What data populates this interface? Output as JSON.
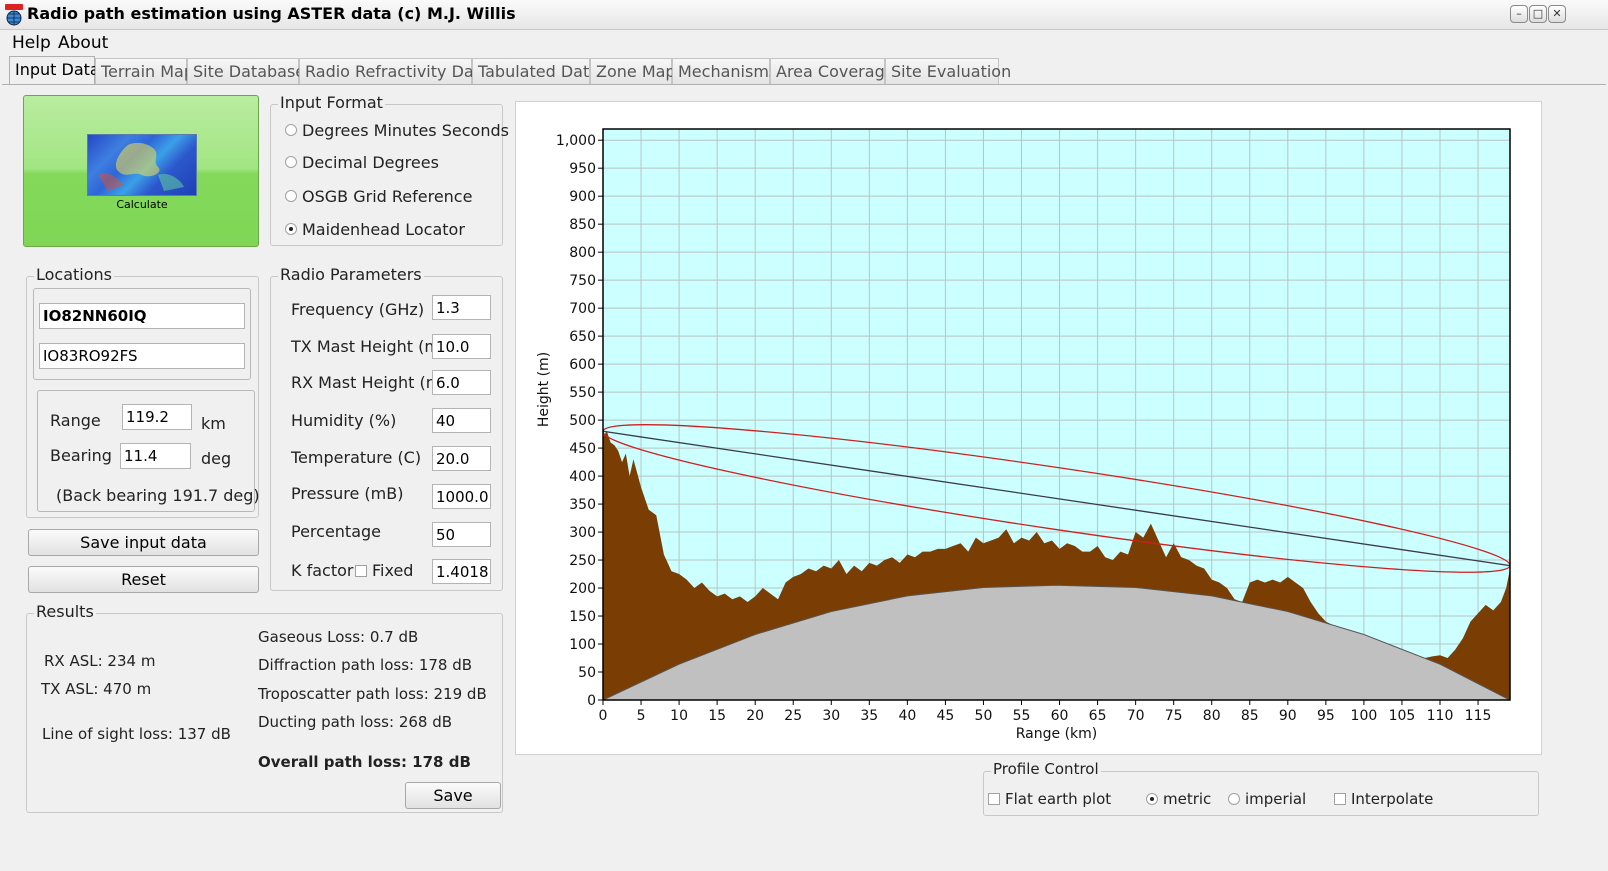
{
  "window": {
    "title": "Radio path estimation using ASTER data (c) M.J. Willis",
    "icon": "globe-app-icon",
    "controls": [
      "minimize",
      "maximize",
      "close"
    ]
  },
  "menu": [
    "Help",
    "About"
  ],
  "tabs": [
    "Input Data",
    "Terrain Map",
    "Site Database",
    "Radio Refractivity Data",
    "Tabulated Data",
    "Zone Map",
    "Mechanisms",
    "Area Coverage",
    "Site Evaluation"
  ],
  "active_tab": "Input Data",
  "calculate": {
    "label": "Calculate",
    "color": "#8fdf67"
  },
  "input_format": {
    "title": "Input Format",
    "options": [
      "Degrees Minutes Seconds",
      "Decimal Degrees",
      "OSGB Grid Reference",
      "Maidenhead Locator"
    ],
    "selected": "Maidenhead Locator"
  },
  "locations": {
    "title": "Locations",
    "tx": "IO82NN60IQ",
    "rx": "IO83RO92FS",
    "range_label": "Range",
    "range_value": "119.2",
    "range_unit": "km",
    "bearing_label": "Bearing",
    "bearing_value": "11.4",
    "bearing_unit": "deg",
    "back_bearing": "(Back bearing 191.7 deg)"
  },
  "buttons": {
    "save_input": "Save input data",
    "reset": "Reset",
    "save": "Save"
  },
  "radio_parameters": {
    "title": "Radio Parameters",
    "rows": [
      {
        "label": "Frequency (GHz)",
        "value": "1.3"
      },
      {
        "label": "TX Mast Height (m)",
        "value": "10.0"
      },
      {
        "label": "RX Mast Height (m)",
        "value": "6.0"
      },
      {
        "label": "Humidity (%)",
        "value": "40"
      },
      {
        "label": "Temperature (C)",
        "value": "20.0"
      },
      {
        "label": "Pressure (mB)",
        "value": "1000.0"
      },
      {
        "label": "Percentage",
        "value": "50"
      }
    ],
    "k_factor_label": "K factor",
    "fixed_label": "Fixed",
    "k_factor_value": "1.4018"
  },
  "results": {
    "title": "Results",
    "rx_asl": "RX ASL: 234 m",
    "tx_asl": "TX ASL: 470 m",
    "los_loss": "Line of sight loss: 137 dB",
    "gaseous_loss": "Gaseous Loss: 0.7 dB",
    "diffraction_loss": "Diffraction path loss: 178 dB",
    "troposcatter_loss": "Troposcatter path loss: 219 dB",
    "ducting_loss": "Ducting path loss: 268 dB",
    "overall_loss": "Overall path loss: 178 dB"
  },
  "profile_control": {
    "title": "Profile Control",
    "flat_earth": "Flat earth plot",
    "metric": "metric",
    "imperial": "imperial",
    "interpolate": "Interpolate",
    "units_selected": "metric"
  },
  "chart_data": {
    "type": "area",
    "xlabel": "Range (km)",
    "ylabel": "Height (m)",
    "xlim": [
      0,
      119.2
    ],
    "ylim": [
      0,
      1020
    ],
    "xticks": [
      0,
      5,
      10,
      15,
      20,
      25,
      30,
      35,
      40,
      45,
      50,
      55,
      60,
      65,
      70,
      75,
      80,
      85,
      90,
      95,
      100,
      105,
      110,
      115
    ],
    "yticks": [
      0,
      50,
      100,
      150,
      200,
      250,
      300,
      350,
      400,
      450,
      500,
      550,
      600,
      650,
      700,
      750,
      800,
      850,
      900,
      950,
      1000
    ],
    "ytick_labels": [
      "0",
      "50",
      "100",
      "150",
      "200",
      "250",
      "300",
      "350",
      "400",
      "450",
      "500",
      "550",
      "600",
      "650",
      "700",
      "750",
      "800",
      "850",
      "900",
      "950",
      "1,000"
    ],
    "grid": true,
    "background": "#ccffff",
    "terrain_color": "#7a3e05",
    "earth_color": "#c0c0c0",
    "los_color": "#3a3a48",
    "fresnel_color": "#cc2020",
    "earth_bulge": {
      "x": [
        0,
        10,
        20,
        30,
        40,
        50,
        59.6,
        70,
        80,
        90,
        100,
        110,
        119.2
      ],
      "y": [
        0,
        64,
        117,
        158,
        186,
        201,
        205,
        201,
        186,
        158,
        117,
        64,
        0
      ]
    },
    "terrain": {
      "x": [
        0,
        0.5,
        1,
        1.5,
        2,
        2.5,
        3,
        3.5,
        4,
        5,
        6,
        7,
        8,
        9,
        10,
        11,
        12,
        13,
        14,
        15,
        16,
        17,
        18,
        19,
        20,
        21,
        22,
        23,
        24,
        25,
        26,
        27,
        28,
        29,
        30,
        31,
        32,
        33,
        34,
        35,
        36,
        37,
        38,
        39,
        40,
        41,
        42,
        43,
        44,
        45,
        46,
        47,
        48,
        49,
        50,
        51,
        52,
        53,
        54,
        55,
        56,
        57,
        58,
        59,
        60,
        61,
        62,
        63,
        64,
        65,
        66,
        67,
        68,
        69,
        70,
        71,
        72,
        73,
        74,
        75,
        76,
        77,
        78,
        79,
        80,
        81,
        82,
        83,
        84,
        85,
        86,
        87,
        88,
        89,
        90,
        91,
        92,
        93,
        94,
        95,
        96,
        97,
        98,
        99,
        100,
        101,
        102,
        103,
        104,
        105,
        106,
        107,
        108,
        109,
        110,
        111,
        112,
        113,
        114,
        115,
        116,
        117,
        118,
        118.7,
        119.2
      ],
      "y": [
        470,
        480,
        460,
        455,
        445,
        425,
        440,
        400,
        430,
        380,
        340,
        330,
        260,
        230,
        225,
        215,
        200,
        210,
        195,
        185,
        190,
        180,
        185,
        175,
        185,
        200,
        190,
        180,
        210,
        220,
        225,
        235,
        230,
        240,
        235,
        250,
        225,
        240,
        230,
        245,
        240,
        250,
        255,
        245,
        260,
        255,
        265,
        265,
        270,
        270,
        275,
        280,
        265,
        290,
        280,
        285,
        290,
        305,
        280,
        290,
        285,
        300,
        280,
        285,
        270,
        280,
        275,
        265,
        265,
        275,
        255,
        250,
        265,
        260,
        300,
        290,
        315,
        285,
        255,
        280,
        255,
        250,
        240,
        235,
        215,
        210,
        200,
        180,
        175,
        210,
        215,
        210,
        215,
        210,
        220,
        210,
        200,
        175,
        155,
        140,
        130,
        125,
        125,
        120,
        110,
        110,
        100,
        95,
        90,
        88,
        85,
        80,
        75,
        78,
        80,
        75,
        90,
        110,
        140,
        155,
        170,
        160,
        175,
        200,
        234
      ]
    },
    "line_of_sight": {
      "x": [
        0,
        119.2
      ],
      "y": [
        480,
        240
      ]
    },
    "fresnel_ellipse": {
      "x0": 0,
      "y0": 480,
      "x1": 119.2,
      "y1": 240,
      "half_width_m": 55
    }
  }
}
